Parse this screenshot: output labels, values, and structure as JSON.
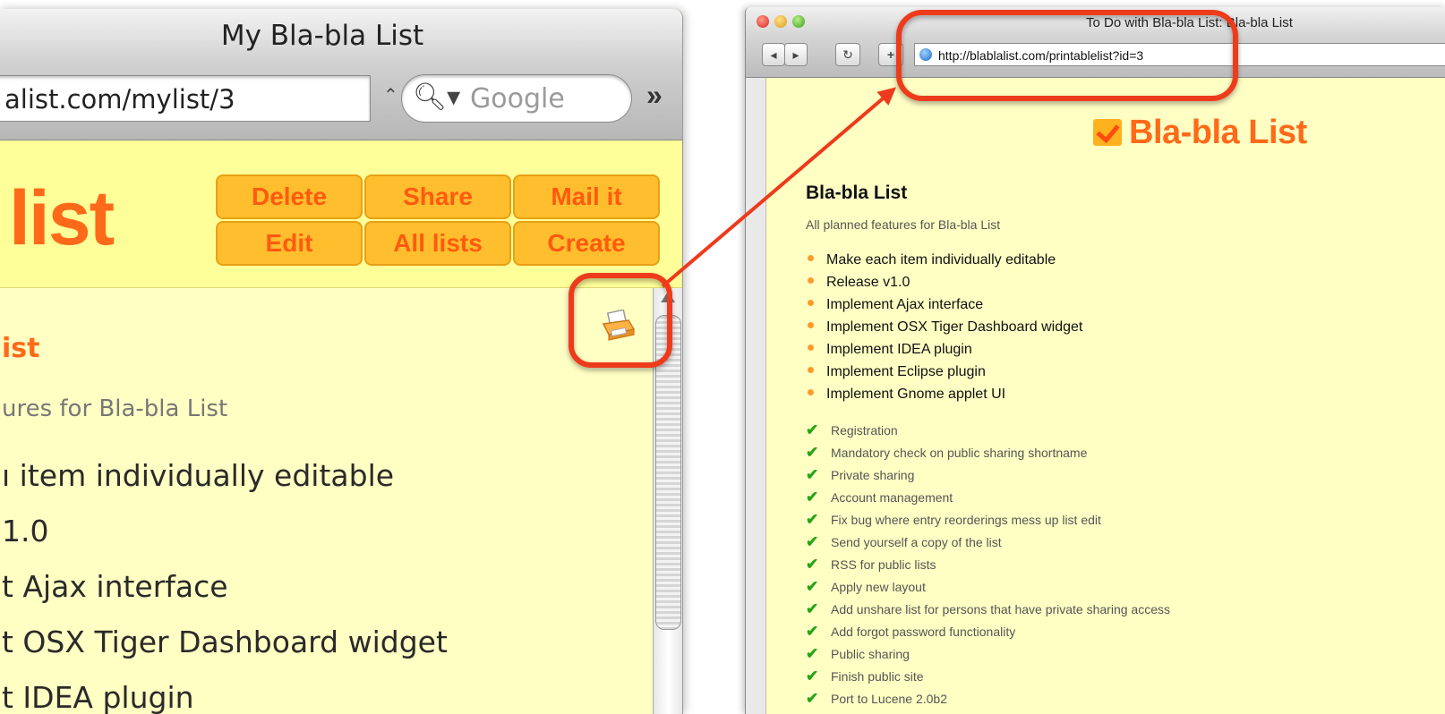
{
  "left_window": {
    "title": "My Bla-bla List",
    "url": "alist.com/mylist/3",
    "search_placeholder": "Google",
    "logo_text": "list",
    "buttons": [
      "Delete",
      "Share",
      "Mail it",
      "Edit",
      "All lists",
      "Create"
    ],
    "list_title": "ist",
    "list_description": "ures for Bla-bla List",
    "items": [
      "ı item individually editable",
      "1.0",
      "t Ajax interface",
      "t OSX Tiger Dashboard widget",
      "t IDEA plugin"
    ],
    "print_icon": "printer-icon"
  },
  "right_window": {
    "title": "To Do with Bla-bla List: Bla-bla List",
    "url": "http://blablalist.com/printablelist?id=3",
    "logo_text": "Bla-bla List",
    "list_title": "Bla-bla List",
    "list_description": "All planned features for Bla-bla List",
    "open_items": [
      "Make each item individually editable",
      "Release v1.0",
      "Implement Ajax interface",
      "Implement OSX Tiger Dashboard widget",
      "Implement IDEA plugin",
      "Implement Eclipse plugin",
      "Implement Gnome applet UI"
    ],
    "done_items": [
      "Registration",
      "Mandatory check on public sharing shortname",
      "Private sharing",
      "Account management",
      "Fix bug where entry reorderings mess up list edit",
      "Send yourself a copy of the list",
      "RSS for public lists",
      "Apply new layout",
      "Add unshare list for persons that have private sharing access",
      "Add forgot password functionality",
      "Public sharing",
      "Finish public site",
      "Port to Lucene 2.0b2"
    ]
  },
  "colors": {
    "accent_orange": "#ff6a1a",
    "button_fill": "#ffbe2e",
    "page_background": "#ffffc4",
    "annotation_red": "#ee3a1c",
    "check_green": "#27a418"
  }
}
